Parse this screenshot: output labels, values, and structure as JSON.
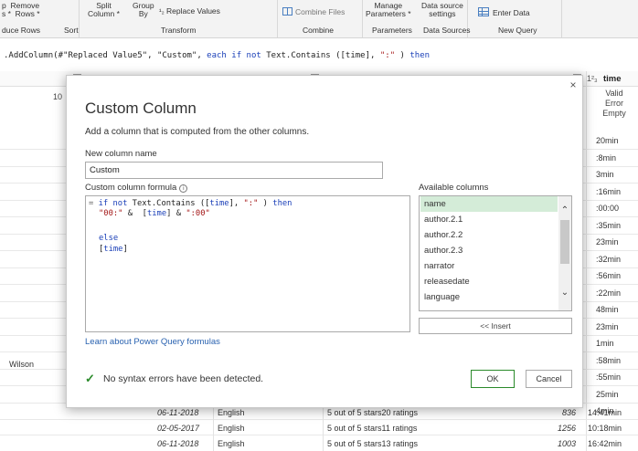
{
  "ribbon": {
    "items": [
      {
        "label": "p  Remove\ns *  Rows *"
      },
      {
        "label": "Split\nColumn *"
      },
      {
        "label": "Group\nBy"
      },
      {
        "label": "Replace Values"
      },
      {
        "label": "Combine Files"
      },
      {
        "label": "Manage\nParameters *"
      },
      {
        "label": "Data source\nsettings"
      },
      {
        "label": "Enter Data"
      }
    ],
    "groups": [
      "duce Rows",
      "Sort",
      "Transform",
      "Combine",
      "Parameters",
      "Data Sources",
      "New Query"
    ]
  },
  "formula_bar": {
    "prefix": ".AddColumn(#\"Replaced Value5\", \"Custom\", ",
    "kw_each": "each",
    "kw_if": "if",
    "kw_not": "not",
    "mid": " Text.Contains ([time], ",
    "str_colon": "\":\"",
    "close": " ) ",
    "kw_then": "then"
  },
  "grid": {
    "column_label": "time",
    "column_icon": "1²₃",
    "quality": [
      "Valid",
      "Error",
      "Empty"
    ],
    "left_value": "10",
    "right_cells": [
      "20min",
      ":8min",
      "3min",
      ":16min",
      ":00:00",
      ":35min",
      "23min",
      ":32min",
      ":56min",
      ":22min",
      "48min",
      "23min",
      "1min",
      ":58min",
      ":55min",
      "25min",
      "4min"
    ],
    "wilson": "Wilson",
    "rows": [
      {
        "date": "06-11-2018",
        "lang": "English",
        "rating": "5 out of 5 stars20 ratings",
        "num": "836",
        "time": "14:41min"
      },
      {
        "date": "02-05-2017",
        "lang": "English",
        "rating": "5 out of 5 stars11 ratings",
        "num": "1256",
        "time": "10:18min"
      },
      {
        "date": "06-11-2018",
        "lang": "English",
        "rating": "5 out of 5 stars13 ratings",
        "num": "1003",
        "time": "16:42min"
      }
    ]
  },
  "dialog": {
    "title": "Custom Column",
    "description": "Add a column that is computed from the other columns.",
    "name_label": "New column name",
    "name_value": "Custom",
    "formula_label": "Custom column formula",
    "info_glyph": "i",
    "formula": {
      "l1_eq": "=",
      "l1_if": "if",
      "l1_not": "not",
      "l1_mid": " Text.Contains ([",
      "l1_time": "time",
      "l1_rest": "], ",
      "l1_str": "\":\"",
      "l1_close": " ) ",
      "l1_then": "then",
      "l2_s1": "\"00:\"",
      "l2_mid": " &  [",
      "l2_time": "time",
      "l2_mid2": "] & ",
      "l2_s2": "\":00\"",
      "l3_else": "else",
      "l4_open": "[",
      "l4_time": "time",
      "l4_close": "]"
    },
    "available_label": "Available columns",
    "available_columns": [
      "name",
      "author.2.1",
      "author.2.2",
      "author.2.3",
      "narrator",
      "releasedate",
      "language"
    ],
    "insert_label": "<< Insert",
    "learn_link": "Learn about Power Query formulas",
    "status": "No syntax errors have been detected.",
    "ok_label": "OK",
    "cancel_label": "Cancel",
    "close_glyph": "×",
    "check_glyph": "✓",
    "colors": {
      "accent_green": "#2a8a2a",
      "selected_bg": "#d4ecd8",
      "link": "#2962b0",
      "keyword": "#1a3fb8",
      "string": "#a31515"
    }
  }
}
